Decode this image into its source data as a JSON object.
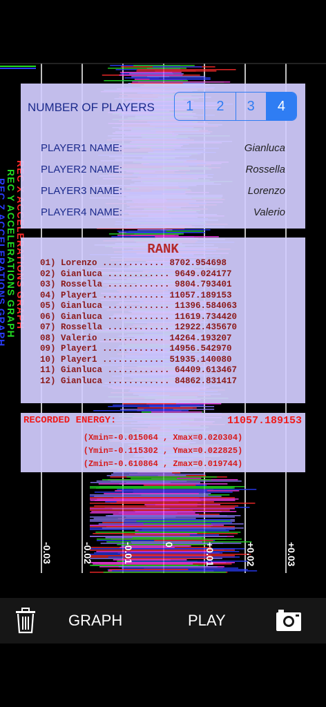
{
  "players": {
    "number_label": "NUMBER OF PLAYERS",
    "options": [
      "1",
      "2",
      "3",
      "4"
    ],
    "selected": "4",
    "rows": [
      {
        "label": "PLAYER1 NAME:",
        "value": "Gianluca"
      },
      {
        "label": "PLAYER2 NAME:",
        "value": "Rossella"
      },
      {
        "label": "PLAYER3 NAME:",
        "value": "Lorenzo"
      },
      {
        "label": "PLAYER4 NAME:",
        "value": "Valerio"
      }
    ]
  },
  "rank": {
    "title": "RANK",
    "entries": [
      "01) Lorenzo ............ 8702.954698",
      "02) Gianluca ............ 9649.024177",
      "03) Rossella ............ 9804.793401",
      "04) Player1 ............ 11057.189153",
      "05) Gianluca ............ 11396.584063",
      "06) Gianluca ............ 11619.734420",
      "07) Rossella ............ 12922.435670",
      "08) Valerio ............ 14264.193207",
      "09) Player1 ............ 14956.542970",
      "10) Player1 ............ 51935.140080",
      "11) Gianluca ............ 64409.613467",
      "12) Gianluca ............ 84862.831417"
    ]
  },
  "energy": {
    "label": "RECORDED ENERGY:",
    "value": "11057.189153",
    "x_range": "(Xmin=-0.015064 , Xmax=0.020304)",
    "y_range": "(Ymin=-0.115302 , Ymax=0.022825)",
    "z_range": "(Zmin=-0.610864 , Zmax=0.019744)"
  },
  "graph_labels": {
    "x": "REC X ACCELERATIONS GRAPH",
    "y": "REC Y ACCELERATIONS GRAPH",
    "z": "REC Z ACCELERATIONS GRAPH",
    "x_color": "#ff2a2a",
    "y_color": "#22dd22",
    "z_color": "#2a3dff"
  },
  "axis_ticks": [
    "-0.03",
    "-0.02",
    "-0.01",
    "0",
    "+0.01",
    "+0.02",
    "+0.03"
  ],
  "toolbar": {
    "trash_icon": "trash-icon",
    "graph_label": "GRAPH",
    "play_label": "PLAY",
    "camera_icon": "camera-icon"
  },
  "colors": {
    "panel": "#d2cdff",
    "selected_segment": "#2f7df3",
    "rank_text": "#8b1a1a",
    "energy_text": "#ee1b1b"
  }
}
